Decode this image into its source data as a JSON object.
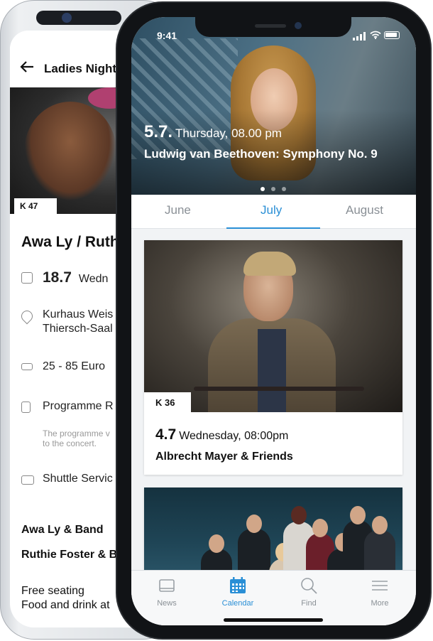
{
  "back_phone": {
    "header": {
      "title": "Ladies Night"
    },
    "badge": "K 47",
    "event_name": "Awa Ly / Ruthi",
    "date": {
      "day": "18.7",
      "weekday": "Wedn"
    },
    "venue": {
      "line1": "Kurhaus Weis",
      "line2": "Thiersch-Saal"
    },
    "price": "25 - 85 Euro",
    "programme": {
      "label": "Programme R",
      "note_line1": "The programme v",
      "note_line2": "to the concert."
    },
    "shuttle": "Shuttle Servic",
    "performers": [
      "Awa Ly & Band",
      "Ruthie Foster & B"
    ],
    "info": [
      "Free seating",
      "Food and drink at"
    ]
  },
  "front_phone": {
    "status_bar": {
      "time": "9:41"
    },
    "hero": {
      "date": "5.7.",
      "day_time": "Thursday, 08.00 pm",
      "title": "Ludwig van Beethoven: Symphony No. 9",
      "pager_count": 3,
      "pager_active": 0
    },
    "month_tabs": [
      {
        "label": "June",
        "active": false
      },
      {
        "label": "July",
        "active": true
      },
      {
        "label": "August",
        "active": false
      }
    ],
    "events": [
      {
        "badge": "K 36",
        "date": "4.7",
        "day_time": "Wednesday, 08:00pm",
        "title": "Albrecht Mayer & Friends"
      }
    ],
    "tab_bar": [
      {
        "label": "News",
        "icon": "news-icon",
        "active": false
      },
      {
        "label": "Calendar",
        "icon": "calendar-icon",
        "active": true
      },
      {
        "label": "Find",
        "icon": "search-icon",
        "active": false
      },
      {
        "label": "More",
        "icon": "menu-icon",
        "active": false
      }
    ]
  },
  "colors": {
    "accent": "#2a8fd6",
    "inactive_text": "#8a9096",
    "list_background": "#f1f3f5"
  }
}
